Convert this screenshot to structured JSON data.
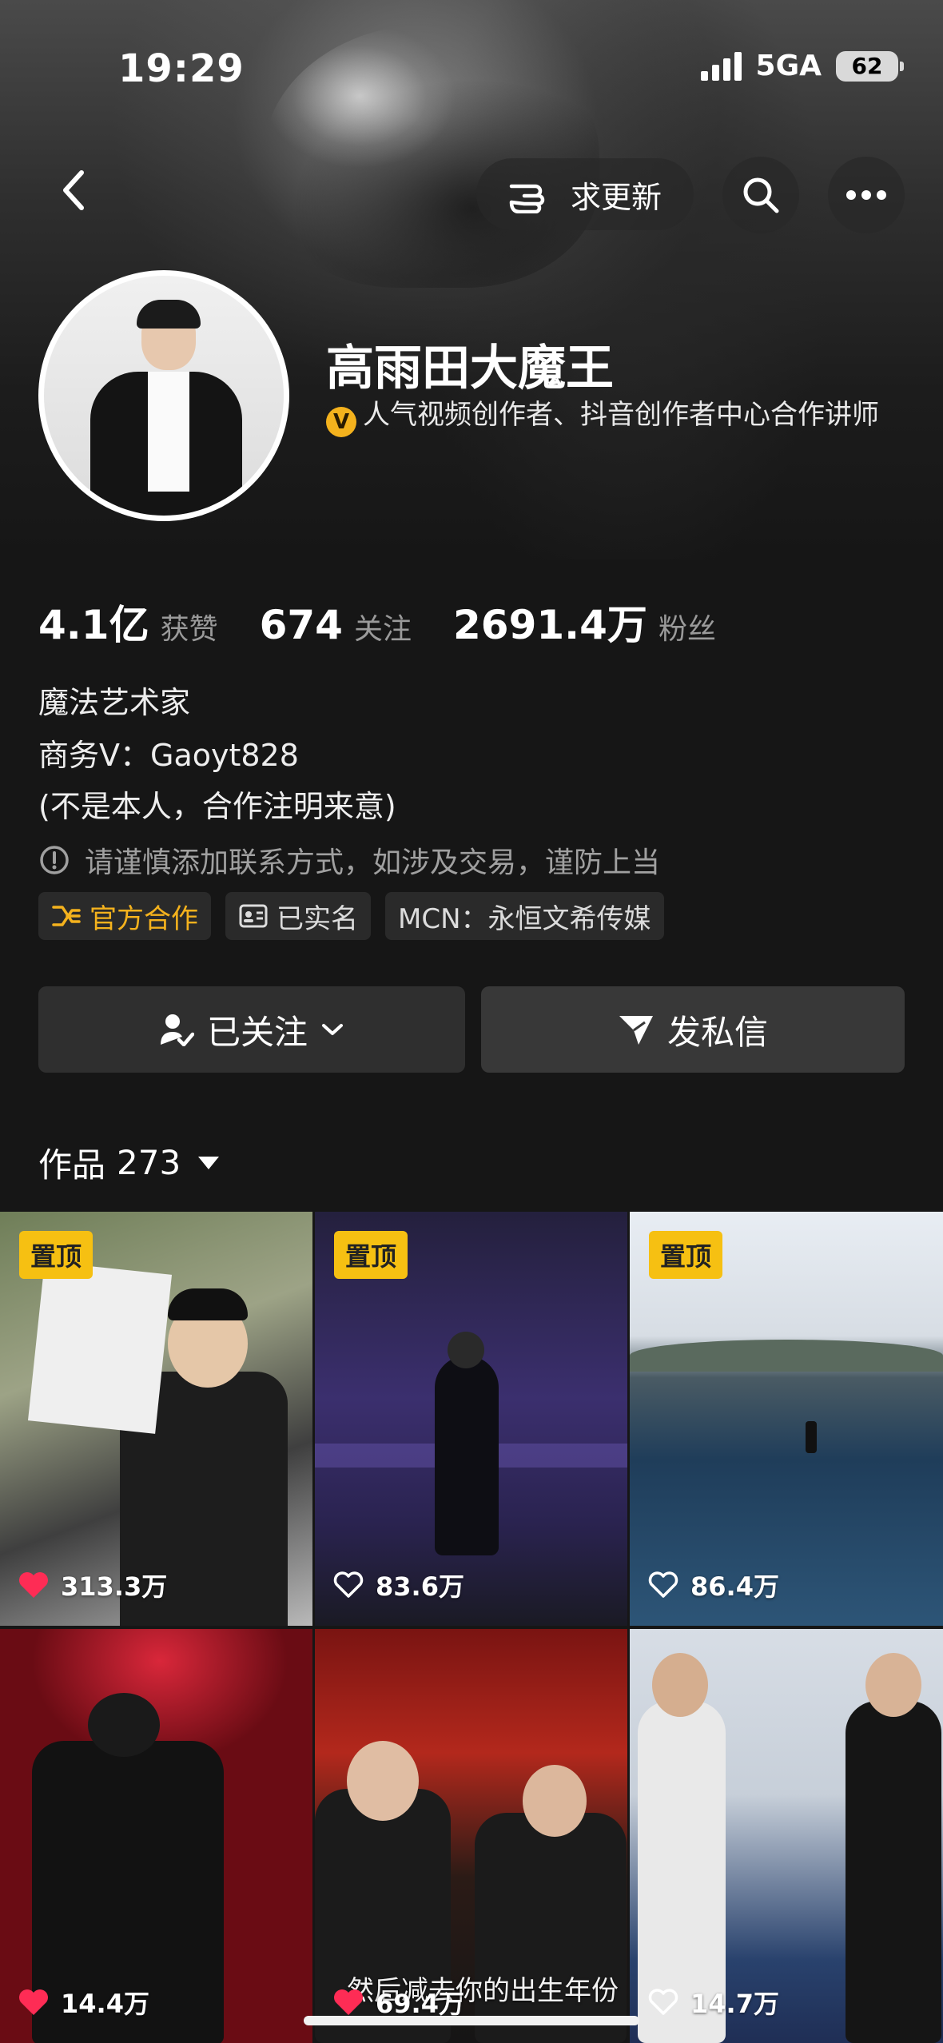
{
  "status_bar": {
    "time": "19:29",
    "network": "5GA",
    "battery": "62"
  },
  "top_nav": {
    "update_label": "求更新"
  },
  "profile": {
    "name": "高雨田大魔王",
    "verify_badge": "V",
    "verify_text": "人气视频创作者、抖音创作者中心合作讲师"
  },
  "stats": [
    {
      "value": "4.1亿",
      "label": "获赞"
    },
    {
      "value": "674",
      "label": "关注"
    },
    {
      "value": "2691.4万",
      "label": "粉丝"
    }
  ],
  "bio": [
    "魔法艺术家",
    "商务V：Gaoyt828",
    "(不是本人，合作注明来意)"
  ],
  "warning": "请谨慎添加联系方式，如涉及交易，谨防上当",
  "tags": {
    "official": "官方合作",
    "verified": "已实名",
    "mcn": "MCN：永恒文希传媒"
  },
  "actions": {
    "follow_label": "已关注",
    "message_label": "发私信"
  },
  "works": {
    "label": "作品",
    "count": "273"
  },
  "videos": [
    {
      "pinned": "置顶",
      "likes": "313.3万",
      "liked": true
    },
    {
      "pinned": "置顶",
      "likes": "83.6万",
      "liked": false
    },
    {
      "pinned": "置顶",
      "likes": "86.4万",
      "liked": false
    },
    {
      "likes": "14.4万",
      "liked": true
    },
    {
      "likes": "69.4万",
      "liked": true,
      "caption": "然后减去你的出生年份"
    },
    {
      "likes": "14.7万",
      "liked": false
    }
  ],
  "colors": {
    "background": "#161616",
    "accent_yellow": "#f6c012",
    "heart_red": "#fe2c55"
  }
}
